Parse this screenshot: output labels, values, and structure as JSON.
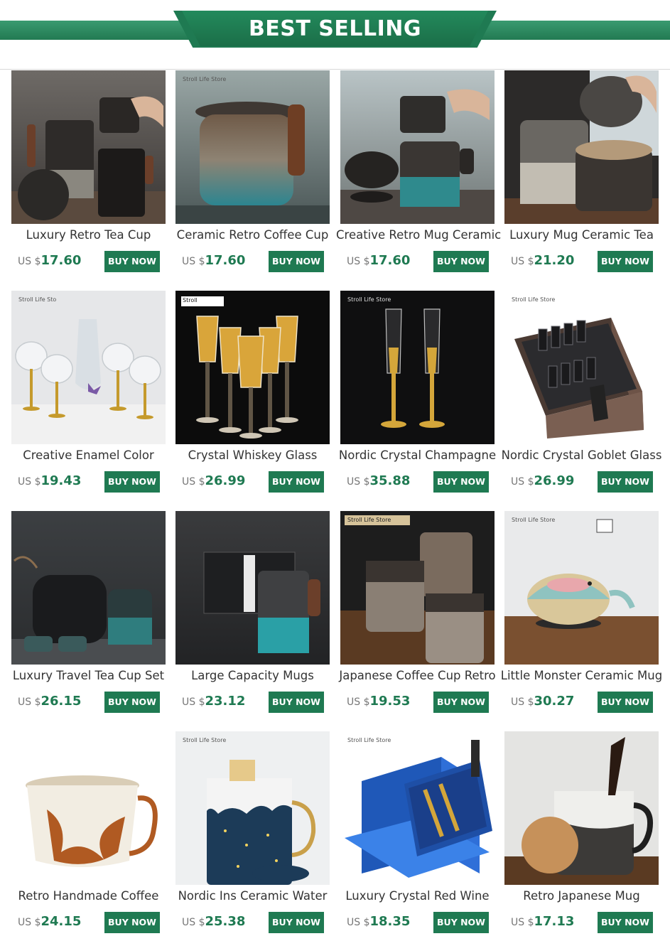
{
  "banner": {
    "title": "BEST SELLING"
  },
  "products": [
    {
      "title": "Luxury Retro Tea Cup",
      "currency": "US $",
      "price": "17.60",
      "button": "BUY NOW"
    },
    {
      "title": "Ceramic Retro Coffee Cup",
      "currency": "US $",
      "price": "17.60",
      "button": "BUY NOW",
      "watermark": "Stroll Life Store"
    },
    {
      "title": "Creative Retro Mug Ceramic",
      "currency": "US $",
      "price": "17.60",
      "button": "BUY NOW"
    },
    {
      "title": "Luxury Mug Ceramic Tea",
      "currency": "US $",
      "price": "21.20",
      "button": "BUY NOW"
    },
    {
      "title": "Creative Enamel Color",
      "currency": "US $",
      "price": "19.43",
      "button": "BUY NOW",
      "watermark": "Stroll Life Sto"
    },
    {
      "title": "Crystal Whiskey Glass",
      "currency": "US $",
      "price": "26.99",
      "button": "BUY NOW",
      "watermark": "Stroll"
    },
    {
      "title": "Nordic Crystal Champagne",
      "currency": "US $",
      "price": "35.88",
      "button": "BUY NOW",
      "watermark": "Stroll Life Store"
    },
    {
      "title": "Nordic Crystal Goblet Glass",
      "currency": "US $",
      "price": "26.99",
      "button": "BUY NOW",
      "watermark": "Stroll Life Store"
    },
    {
      "title": "Luxury Travel Tea Cup Set",
      "currency": "US $",
      "price": "26.15",
      "button": "BUY NOW"
    },
    {
      "title": "Large Capacity Mugs",
      "currency": "US $",
      "price": "23.12",
      "button": "BUY NOW"
    },
    {
      "title": "Japanese Coffee Cup Retro",
      "currency": "US $",
      "price": "19.53",
      "button": "BUY NOW",
      "watermark": "Stroll Life Store"
    },
    {
      "title": "Little Monster Ceramic Mug",
      "currency": "US $",
      "price": "30.27",
      "button": "BUY NOW",
      "watermark": "Stroll Life Store"
    },
    {
      "title": "Retro Handmade Coffee",
      "currency": "US $",
      "price": "24.15",
      "button": "BUY NOW"
    },
    {
      "title": "Nordic Ins Ceramic Water",
      "currency": "US $",
      "price": "25.38",
      "button": "BUY NOW",
      "watermark": "Stroll Life Store"
    },
    {
      "title": "Luxury Crystal Red Wine",
      "currency": "US $",
      "price": "18.35",
      "button": "BUY NOW",
      "watermark": "Stroll Life Store"
    },
    {
      "title": "Retro Japanese Mug",
      "currency": "US $",
      "price": "17.13",
      "button": "BUY NOW"
    }
  ]
}
